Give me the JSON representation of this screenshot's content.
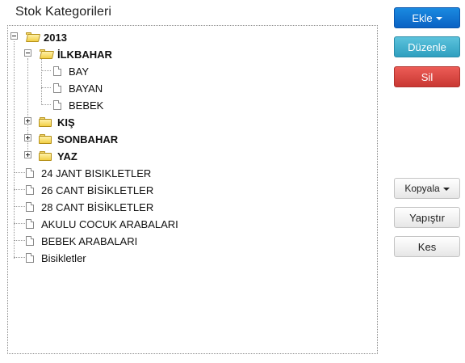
{
  "header": {
    "title": "Stok Kategorileri"
  },
  "tree": {
    "root": {
      "label": "2013"
    },
    "ilkbahar": {
      "label": "İLKBAHAR",
      "children": [
        "BAY",
        "BAYAN",
        "BEBEK"
      ]
    },
    "kis": {
      "label": "KIŞ"
    },
    "sonbahar": {
      "label": "SONBAHAR"
    },
    "yaz": {
      "label": "YAZ"
    },
    "items": [
      "24 JANT BISIKLETLER",
      "26 CANT BİSİKLETLER",
      "28 CANT BİSİKLETLER",
      "AKULU COCUK ARABALARI",
      "BEBEK ARABALARI",
      "Bisikletler"
    ]
  },
  "toolbar": {
    "add_label": "Ekle",
    "edit_label": "Düzenle",
    "delete_label": "Sil",
    "copy_label": "Kopyala",
    "paste_label": "Yapıştır",
    "cut_label": "Kes"
  },
  "colors": {
    "primary": "#0a6fd1",
    "info": "#45b3d2",
    "danger": "#da4a45",
    "folder": "#f2cf46"
  },
  "icons": {
    "folder": "folder-icon",
    "file": "file-icon",
    "expander_open": "collapse-icon",
    "expander_closed": "expand-icon"
  }
}
